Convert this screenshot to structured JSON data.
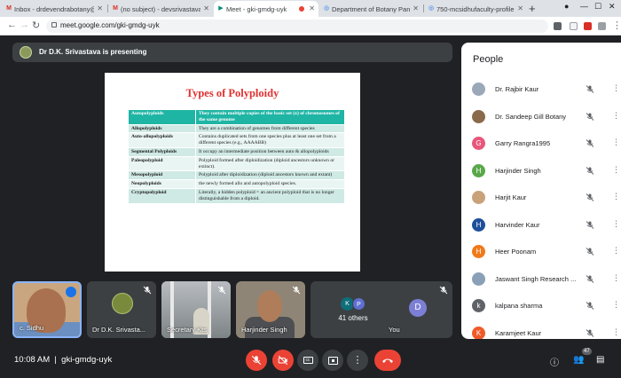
{
  "browser": {
    "tabs": [
      {
        "title": "Inbox - drdevendrabotany@",
        "icon": "gmail-icon"
      },
      {
        "title": "(no subject) - devsrivastava",
        "icon": "gmail-icon"
      },
      {
        "title": "Meet - gki-gmdg-uyk",
        "icon": "meet-icon",
        "active": true
      },
      {
        "title": "Department of Botany Pan",
        "icon": "globe-icon"
      },
      {
        "title": "750-mcsidhufaculty-profile",
        "icon": "globe-icon"
      }
    ],
    "url": "meet.google.com/gki-gmdg-uyk"
  },
  "meet": {
    "presenting_text": "Dr D.K. Srivastava is presenting",
    "slide": {
      "title": "Types of Polyploidy",
      "header": {
        "term": "Autopolyploids",
        "definition": "They contain multiple copies of the basic set (x) of chromosomes of the same genome"
      },
      "rows": [
        {
          "term": "Allopolyploids",
          "definition": "They are a combination of genomes from different species"
        },
        {
          "term": "Auto-allopolyploids",
          "definition": "Contains duplicated sets from one species plus at least one set from a different species (e.g., AAAABB)"
        },
        {
          "term": "Segmental Polyploids",
          "definition": "It occupy an intermediate position between auto & allopolyploids"
        },
        {
          "term": "Paleopolyploid",
          "definition": "Polyploid formed after diploidization (diploid ancestors unknown or extinct)."
        },
        {
          "term": "Mesopolyploid",
          "definition": "Polyploid after diploidization (diploid ancestors known and extant)"
        },
        {
          "term": "Neopolyploids",
          "definition": "the newly formed allo and autopolyploid species."
        },
        {
          "term": "Cryptopolyploid",
          "definition": "Literally, a hidden polyploid = an ancient polyploid that is no longer distinguishable from a diploid."
        }
      ]
    },
    "tiles": {
      "sidhu": "c. Sidhu",
      "dk": "Dr D.K. Srivasta...",
      "sec": "Secretary Kts",
      "harj": "Harjinder Singh",
      "others": {
        "avatar1": "K",
        "avatar2": "P",
        "count": "41 others"
      },
      "you": {
        "avatar": "D",
        "label": "You"
      }
    },
    "bottom": {
      "time": "10:08 AM",
      "meeting_code": "gki-gmdg-uyk",
      "participant_count": "47"
    },
    "people": {
      "header": "People",
      "list": [
        {
          "name": "Dr. Rajbir Kaur",
          "initial": "",
          "color": "#9aa8b8"
        },
        {
          "name": "Dr. Sandeep Gill Botany",
          "initial": "",
          "color": "#8a6a4a"
        },
        {
          "name": "Garry Rangra1995",
          "initial": "G",
          "color": "#e8567a"
        },
        {
          "name": "Harjinder Singh",
          "initial": "H",
          "color": "#5aa84a"
        },
        {
          "name": "Harjit Kaur",
          "initial": "",
          "color": "#c9a27a"
        },
        {
          "name": "Harvinder Kaur",
          "initial": "H",
          "color": "#1e4f9a"
        },
        {
          "name": "Heer Poonam",
          "initial": "H",
          "color": "#f07a1a"
        },
        {
          "name": "Jaswant Singh Research ...",
          "initial": "",
          "color": "#8aa0b8"
        },
        {
          "name": "kalpana sharma",
          "initial": "k",
          "color": "#5f6368"
        },
        {
          "name": "Karamjeet Kaur",
          "initial": "K",
          "color": "#f05a28"
        }
      ]
    }
  }
}
